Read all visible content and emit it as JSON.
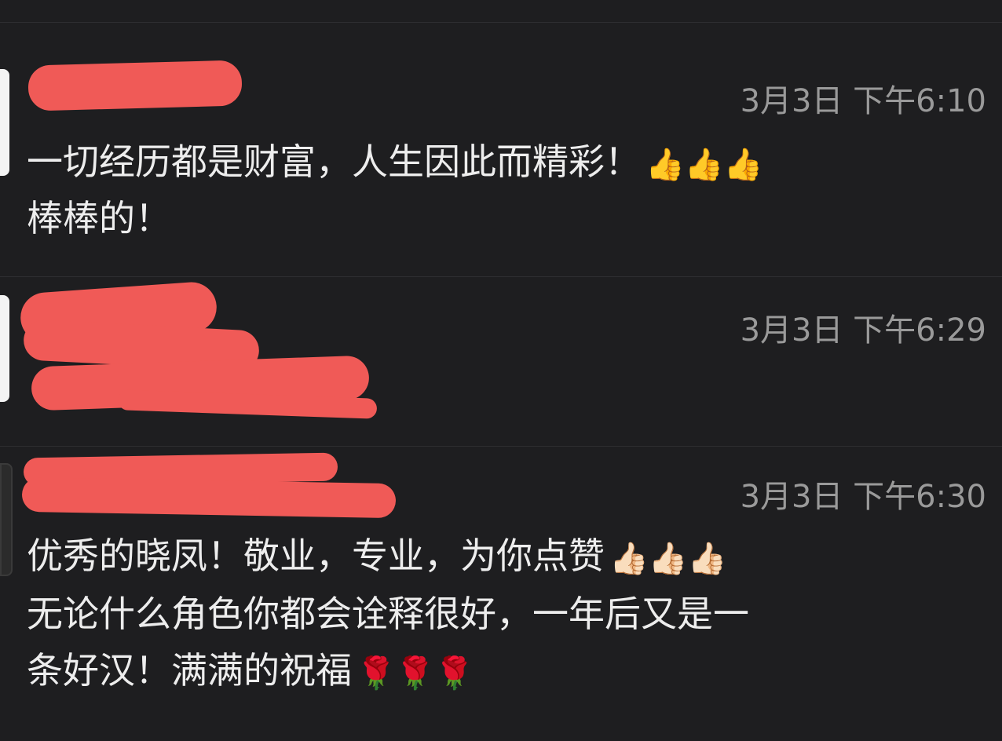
{
  "comments": [
    {
      "time": "3月3日 下午6:10",
      "text_line1": "一切经历都是财富，人生因此而精彩！",
      "text_line2": "棒棒的！",
      "emoji_1": "👍👍👍"
    },
    {
      "time": "3月3日 下午6:29"
    },
    {
      "time": "3月3日 下午6:30",
      "text_line1": "优秀的晓凤！敬业，专业，为你点赞",
      "emoji_1": "👍🏻👍🏻👍🏻",
      "text_line2": "无论什么角色你都会诠释很好，一年后又是一",
      "text_line3": "条好汉！满满的祝福",
      "emoji_3": "🌹🌹🌹"
    }
  ],
  "colors": {
    "background": "#1e1e20",
    "redaction": "#f05a57",
    "timestamp": "#9a9a9a",
    "text": "#ededed"
  }
}
